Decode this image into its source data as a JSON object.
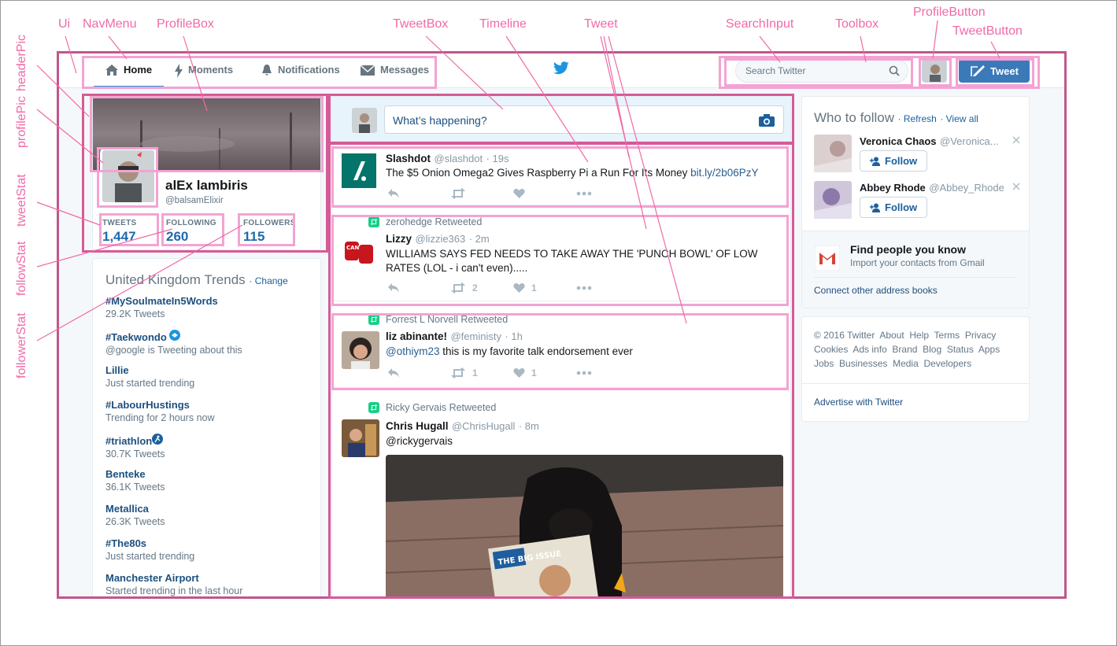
{
  "annotations": {
    "ui": "Ui",
    "nav_menu": "NavMenu",
    "profile_box": "ProfileBox",
    "tweet_box": "TweetBox",
    "timeline": "Timeline",
    "tweet": "Tweet",
    "search_input": "SearchInput",
    "toolbox": "Toolbox",
    "profile_button": "ProfileButton",
    "tweet_button": "TweetButton",
    "header_pic": "headerPic",
    "profile_pic": "profilePic",
    "tweet_stat": "tweetStat",
    "follow_stat": "followStat",
    "follower_stat": "followerStat"
  },
  "nav": {
    "home": "Home",
    "moments": "Moments",
    "notifications": "Notifications",
    "messages": "Messages"
  },
  "toolbox": {
    "search_placeholder": "Search Twitter",
    "tweet_label": "Tweet"
  },
  "profile": {
    "name": "alEx lambiris",
    "handle": "@balsamElixir",
    "stats": [
      {
        "label": "TWEETS",
        "value": "1,447"
      },
      {
        "label": "FOLLOWING",
        "value": "260"
      },
      {
        "label": "FOLLOWERS",
        "value": "115"
      }
    ]
  },
  "trends": {
    "title": "United Kingdom Trends",
    "change": "Change",
    "items": [
      {
        "tag": "#MySoulmateIn5Words",
        "sub": "29.2K Tweets"
      },
      {
        "tag": "#Taekwondo",
        "sub": "@google is Tweeting about this"
      },
      {
        "tag": "Lillie",
        "sub": "Just started trending"
      },
      {
        "tag": "#LabourHustings",
        "sub": "Trending for 2 hours now"
      },
      {
        "tag": "#triathlon",
        "sub": "30.7K Tweets"
      },
      {
        "tag": "Benteke",
        "sub": "36.1K Tweets"
      },
      {
        "tag": "Metallica",
        "sub": "26.3K Tweets"
      },
      {
        "tag": "#The80s",
        "sub": "Just started trending"
      },
      {
        "tag": "Manchester Airport",
        "sub": "Started trending in the last hour"
      }
    ]
  },
  "compose": {
    "placeholder": "What’s happening?"
  },
  "tweets": [
    {
      "retweeted_by": "",
      "name": "Slashdot",
      "handle": "@slashdot",
      "time": "· 19s",
      "text": "The $5 Onion Omega2 Gives Raspberry Pi a Run For Its Money ",
      "link": "bit.ly/2b06PzY",
      "retweets": "",
      "likes": ""
    },
    {
      "retweeted_by": "zerohedge Retweeted",
      "name": "Lizzy",
      "handle": "@lizzie363",
      "time": "· 2m",
      "text": "WILLIAMS SAYS FED NEEDS TO TAKE AWAY THE 'PUNCH BOWL' OF LOW RATES (LOL - i can't even).....",
      "link": "",
      "retweets": "2",
      "likes": "1"
    },
    {
      "retweeted_by": "Forrest L Norvell Retweeted",
      "name": "liz abinante!",
      "handle": "@feministy",
      "time": "· 1h",
      "text": "",
      "mention": "@othiym23",
      "text_after": " this is my favorite talk endorsement ever",
      "retweets": "1",
      "likes": "1"
    },
    {
      "retweeted_by": "Ricky Gervais Retweeted",
      "name": "Chris Hugall",
      "handle": "@ChrisHugall",
      "time": "· 8m",
      "mention": "@rickygervais",
      "photo_text": "THE BIG ISSUE"
    }
  ],
  "who_to_follow": {
    "title": "Who to follow",
    "refresh": "· Refresh",
    "view_all": "· View all",
    "users": [
      {
        "name": "Veronica Chaos",
        "handle": "@Veronica...",
        "button": "Follow"
      },
      {
        "name": "Abbey Rhode",
        "handle": "@Abbey_Rhode",
        "button": "Follow"
      }
    ],
    "find_title": "Find people you know",
    "find_sub": "Import your contacts from Gmail",
    "connect": "Connect other address books"
  },
  "footer": {
    "row1": [
      "© 2016 Twitter",
      "About",
      "Help",
      "Terms",
      "Privacy"
    ],
    "row2": [
      "Cookies",
      "Ads info",
      "Brand",
      "Blog",
      "Status",
      "Apps"
    ],
    "row3": [
      "Jobs",
      "Businesses",
      "Media",
      "Developers"
    ],
    "advertise": "Advertise with Twitter"
  },
  "colors": {
    "annotation": "#f06aa7",
    "highlight_light": "#f3a3d3",
    "highlight_dark": "#c0578c",
    "twitter_blue": "#1b95e0",
    "tweet_button": "#3b7ab8"
  },
  "icons": [
    "home-icon",
    "lightning-icon",
    "bell-icon",
    "envelope-icon",
    "twitter-bird-icon",
    "search-icon",
    "compose-icon",
    "camera-icon",
    "reply-icon",
    "retweet-icon",
    "heart-icon",
    "more-icon",
    "add-user-icon",
    "close-icon",
    "gmail-icon"
  ]
}
